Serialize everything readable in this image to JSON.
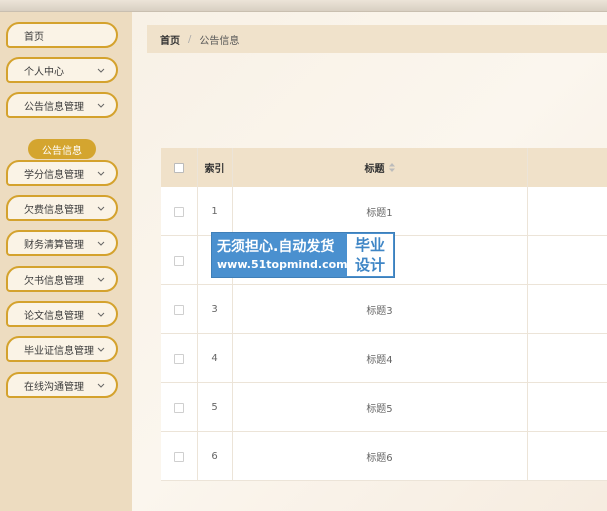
{
  "sidebar": {
    "items": [
      {
        "label": "首页",
        "has_chevron": false
      },
      {
        "label": "个人中心",
        "has_chevron": true
      },
      {
        "label": "公告信息管理",
        "has_chevron": true
      },
      {
        "label": "学分信息管理",
        "has_chevron": true
      },
      {
        "label": "欠费信息管理",
        "has_chevron": true
      },
      {
        "label": "财务清算管理",
        "has_chevron": true
      },
      {
        "label": "欠书信息管理",
        "has_chevron": true
      },
      {
        "label": "论文信息管理",
        "has_chevron": true
      },
      {
        "label": "毕业证信息管理",
        "has_chevron": true
      },
      {
        "label": "在线沟通管理",
        "has_chevron": true
      }
    ],
    "active_sub_item": "公告信息"
  },
  "breadcrumb": {
    "home": "首页",
    "separator": "/",
    "current": "公告信息"
  },
  "table": {
    "headers": {
      "index": "索引",
      "title": "标题"
    },
    "rows": [
      {
        "index": "1",
        "title": "标题1"
      },
      {
        "index": "",
        "title": ""
      },
      {
        "index": "3",
        "title": "标题3"
      },
      {
        "index": "4",
        "title": "标题4"
      },
      {
        "index": "5",
        "title": "标题5"
      },
      {
        "index": "6",
        "title": "标题6"
      }
    ]
  },
  "watermark": {
    "line1": "无须担心.自动发货",
    "line2": "www.51topmind.com",
    "badge_line1": "毕业",
    "badge_line2": "设计"
  },
  "colors": {
    "accent": "#d4a22d",
    "sidebar_bg": "#eddcc0",
    "header_bg": "#f0e1c9",
    "watermark_blue": "#4a90cf"
  }
}
